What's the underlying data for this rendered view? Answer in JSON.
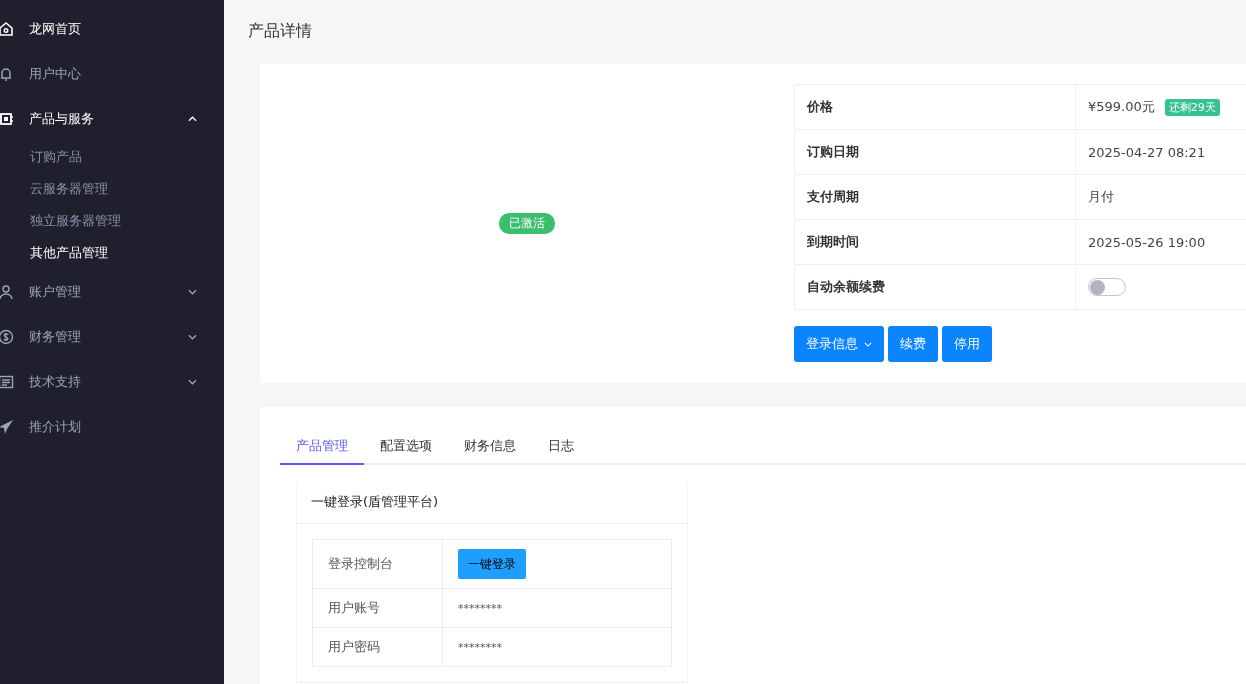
{
  "sidebar": {
    "items": [
      {
        "label": "龙网首页",
        "highlighted": true
      },
      {
        "label": "用户中心",
        "highlighted": false
      },
      {
        "label": "产品与服务",
        "highlighted": true,
        "expanded": true,
        "children": [
          {
            "label": "订购产品",
            "selected": false
          },
          {
            "label": "云服务器管理",
            "selected": false
          },
          {
            "label": "独立服务器管理",
            "selected": false
          },
          {
            "label": "其他产品管理",
            "selected": true
          }
        ]
      },
      {
        "label": "账户管理",
        "highlighted": false,
        "expanded": false
      },
      {
        "label": "财务管理",
        "highlighted": false,
        "expanded": false
      },
      {
        "label": "技术支持",
        "highlighted": false,
        "expanded": false
      },
      {
        "label": "推介计划",
        "highlighted": false
      }
    ]
  },
  "page_title": "产品详情",
  "product": {
    "status": "已激活",
    "details": [
      {
        "kind": "text",
        "label": "价格",
        "value": "¥599.00元",
        "badge": "还剩29天"
      },
      {
        "kind": "text",
        "label": "订购日期",
        "value": "2025-04-27 08:21"
      },
      {
        "kind": "text",
        "label": "支付周期",
        "value": "月付"
      },
      {
        "kind": "text",
        "label": "到期时间",
        "value": "2025-05-26 19:00"
      },
      {
        "kind": "switch",
        "label": "自动余额续费",
        "on": false
      }
    ],
    "buttons": [
      {
        "label": "登录信息",
        "dropdown": true
      },
      {
        "label": "续费",
        "dropdown": false
      },
      {
        "label": "停用",
        "dropdown": false
      }
    ]
  },
  "tabs": [
    {
      "label": "产品管理",
      "selected": true
    },
    {
      "label": "配置选项",
      "selected": false
    },
    {
      "label": "财务信息",
      "selected": false
    },
    {
      "label": "日志",
      "selected": false
    }
  ],
  "login_panel": {
    "title": "一键登录(盾管理平台)",
    "rows": [
      {
        "kind": "button",
        "label": "登录控制台",
        "value": "一键登录"
      },
      {
        "kind": "text",
        "label": "用户账号",
        "value": "********"
      },
      {
        "kind": "text",
        "label": "用户密码",
        "value": "********"
      }
    ]
  }
}
